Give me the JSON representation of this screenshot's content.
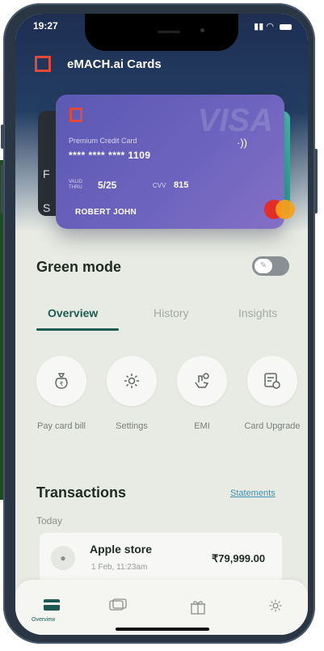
{
  "status_bar": {
    "time": "19:27"
  },
  "app": {
    "title": "eMACH.ai Cards"
  },
  "card": {
    "type": "Premium Credit Card",
    "number": "**** **** **** 1109",
    "valid_label": "VALID THRU",
    "valid": "5/25",
    "cvv_label": "CVV",
    "cvv": "815",
    "holder": "ROBERT JOHN",
    "network_watermark": "VISA"
  },
  "background_card": {
    "line1": "F",
    "line2": "S"
  },
  "green_mode": {
    "label": "Green mode",
    "enabled": false
  },
  "tabs": [
    {
      "label": "Overview",
      "active": true
    },
    {
      "label": "History",
      "active": false
    },
    {
      "label": "Insights",
      "active": false
    }
  ],
  "actions": [
    {
      "label": "Pay card bill",
      "icon": "money-bag-icon"
    },
    {
      "label": "Settings",
      "icon": "gear-icon"
    },
    {
      "label": "EMI",
      "icon": "hand-coin-icon"
    },
    {
      "label": "Card Upgrade",
      "icon": "card-refresh-icon"
    }
  ],
  "transactions": {
    "title": "Transactions",
    "statements_link": "Statements",
    "group": "Today",
    "items": [
      {
        "merchant": "Apple store",
        "date": "1 Feb, 11:23am",
        "amount": "₹79,999.00"
      }
    ]
  },
  "bottom_nav": {
    "items": [
      {
        "label": "Overview",
        "icon": "card-icon",
        "active": true
      },
      {
        "label": "",
        "icon": "cards-stack-icon",
        "active": false
      },
      {
        "label": "",
        "icon": "gift-icon",
        "active": false
      },
      {
        "label": "",
        "icon": "gear-icon",
        "active": false
      }
    ]
  },
  "colors": {
    "accent": "#1c5a52",
    "card": "#6c63be",
    "brand_red": "#e34a34",
    "link": "#3c8fb0"
  }
}
